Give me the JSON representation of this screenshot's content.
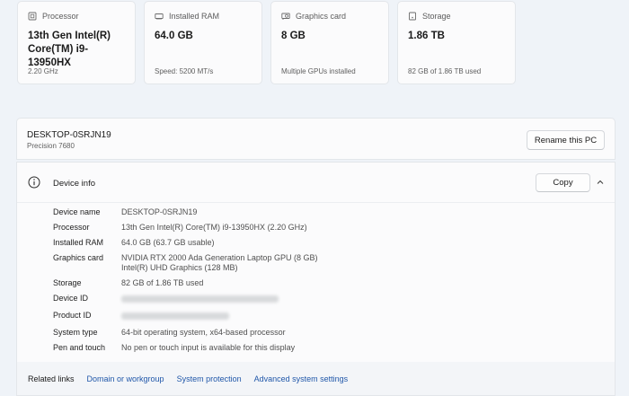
{
  "specs": [
    {
      "icon": "processor-icon",
      "label": "Processor",
      "value": "13th Gen Intel(R) Core(TM) i9-13950HX",
      "sub": "2.20 GHz"
    },
    {
      "icon": "ram-icon",
      "label": "Installed RAM",
      "value": "64.0 GB",
      "sub": "Speed: 5200 MT/s"
    },
    {
      "icon": "graphics-card-icon",
      "label": "Graphics card",
      "value": "8 GB",
      "sub": "Multiple GPUs installed"
    },
    {
      "icon": "storage-icon",
      "label": "Storage",
      "value": "1.86 TB",
      "sub": "82 GB of 1.86 TB used"
    }
  ],
  "pc": {
    "name": "DESKTOP-0SRJN19",
    "model": "Precision 7680",
    "rename_label": "Rename this PC"
  },
  "device_info": {
    "title": "Device info",
    "copy_label": "Copy",
    "rows": {
      "device_name": {
        "key": "Device name",
        "value": "DESKTOP-0SRJN19"
      },
      "processor": {
        "key": "Processor",
        "value": "13th Gen Intel(R) Core(TM) i9-13950HX (2.20 GHz)"
      },
      "installed_ram": {
        "key": "Installed RAM",
        "value": "64.0 GB (63.7 GB usable)"
      },
      "graphics_card": {
        "key": "Graphics card",
        "value": "NVIDIA RTX 2000 Ada Generation Laptop GPU (8 GB)",
        "value2": "Intel(R) UHD Graphics (128 MB)"
      },
      "storage": {
        "key": "Storage",
        "value": "82 GB of 1.86 TB used"
      },
      "device_id": {
        "key": "Device ID"
      },
      "product_id": {
        "key": "Product ID"
      },
      "system_type": {
        "key": "System type",
        "value": "64-bit operating system, x64-based processor"
      },
      "pen_touch": {
        "key": "Pen and touch",
        "value": "No pen or touch input is available for this display"
      }
    }
  },
  "related_links": {
    "label": "Related links",
    "links": [
      "Domain or workgroup",
      "System protection",
      "Advanced system settings"
    ]
  }
}
